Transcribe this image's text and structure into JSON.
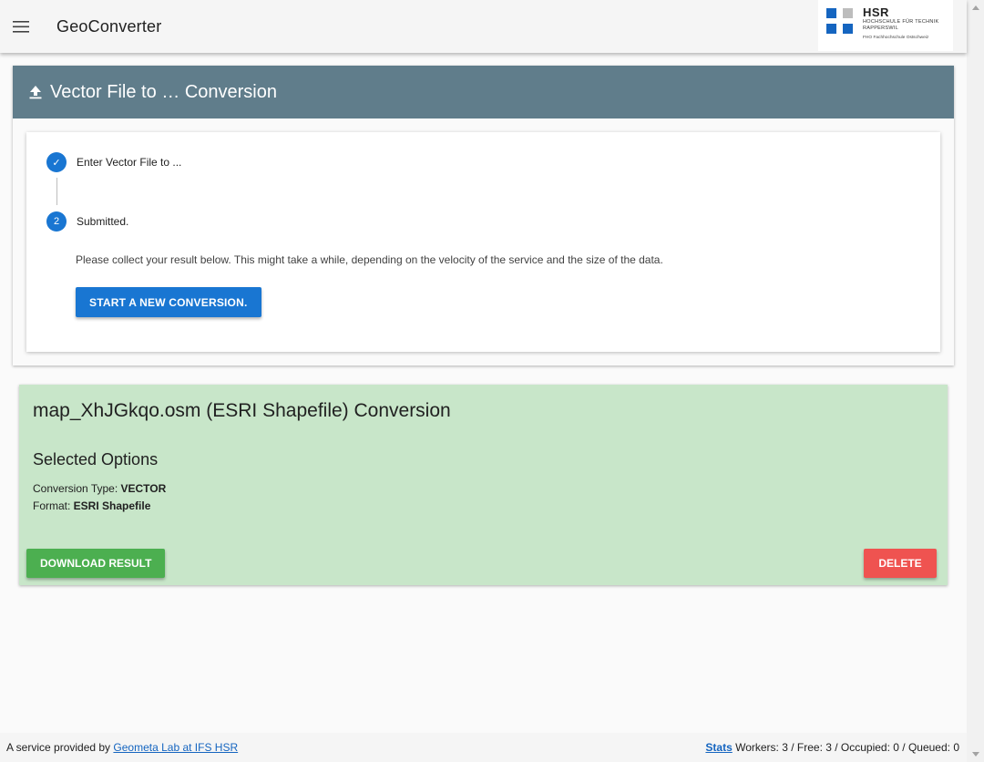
{
  "header": {
    "app_title": "GeoConverter",
    "menu_icon": "hamburger-menu-icon",
    "logo": {
      "name": "HSR",
      "line1": "HOCHSCHULE FÜR TECHNIK",
      "line2": "RAPPERSWIL",
      "line3": "FHO Fachhochschule Ostschweiz",
      "colors": [
        "#1565c0",
        "#bdbdbd",
        "#1565c0",
        "#1565c0"
      ]
    }
  },
  "main_card": {
    "title": "Vector File to … Conversion",
    "title_icon": "upload-icon",
    "steps": [
      {
        "marker": "✓",
        "label": "Enter Vector File to ...",
        "state": "done"
      },
      {
        "marker": "2",
        "label": "Submitted.",
        "state": "active"
      }
    ],
    "message": "Please collect your result below. This might take a while, depending on the velocity of the service and the size of the data.",
    "new_button": "START A NEW CONVERSION."
  },
  "result": {
    "title": "map_XhJGkqo.osm (ESRI Shapefile) Conversion",
    "options_heading": "Selected Options",
    "options": [
      {
        "label": "Conversion Type: ",
        "value": "VECTOR"
      },
      {
        "label": "Format: ",
        "value": "ESRI Shapefile"
      }
    ],
    "download_button": "DOWNLOAD RESULT",
    "delete_button": "DELETE"
  },
  "footer": {
    "provided_by": "A service provided by ",
    "provider_link": "Geometa Lab at IFS HSR",
    "stats_link": "Stats",
    "stats_text": " Workers: 3 / Free: 3 / Occupied: 0 / Queued: 0"
  },
  "colors": {
    "primary": "#1976d2",
    "header_card": "#607d8b",
    "result_bg": "#c8e6c9",
    "success": "#4caf50",
    "danger": "#ef5350"
  }
}
